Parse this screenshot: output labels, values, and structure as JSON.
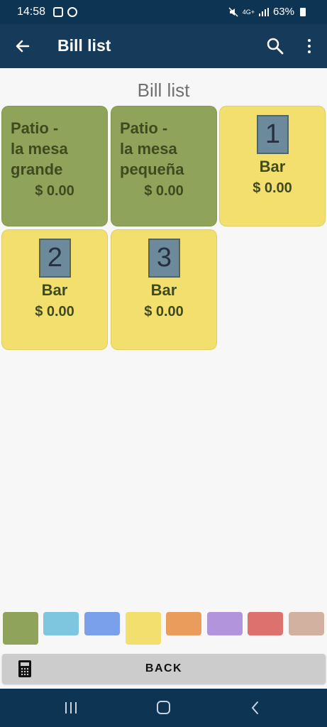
{
  "status_bar": {
    "time": "14:58",
    "network": "4G+",
    "battery": "63%"
  },
  "app_bar": {
    "title": "Bill list",
    "icons": [
      "back-arrow-icon",
      "search-icon",
      "more-vert-icon"
    ]
  },
  "page": {
    "heading": "Bill list"
  },
  "bills": [
    {
      "name_lines": [
        "Patio -",
        "la mesa",
        "grande"
      ],
      "amount": "$ 0.00",
      "color": "#8fa45a"
    },
    {
      "name_lines": [
        "Patio -",
        "la mesa",
        "pequeña"
      ],
      "amount": "$ 0.00",
      "color": "#8fa45a"
    },
    {
      "number": "1",
      "label": "Bar",
      "amount": "$ 0.00",
      "color": "#f3df6e"
    },
    {
      "number": "2",
      "label": "Bar",
      "amount": "$ 0.00",
      "color": "#f3df6e"
    },
    {
      "number": "3",
      "label": "Bar",
      "amount": "$ 0.00",
      "color": "#f3df6e"
    }
  ],
  "color_filters": {
    "colors": [
      "#8fa45a",
      "#7ec6e0",
      "#7aa0ec",
      "#f3df6e",
      "#e99c5c",
      "#b294dc",
      "#dd716d",
      "#d3b1a1"
    ],
    "selected": "#f3df6e"
  },
  "back_button": {
    "label": "BACK",
    "icon": "calculator-icon"
  },
  "nav_bar": {
    "icons": [
      "recent-apps-icon",
      "home-icon",
      "back-icon"
    ]
  }
}
